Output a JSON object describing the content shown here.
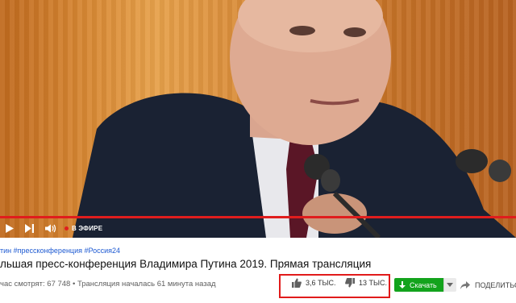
{
  "player": {
    "live_label": "В ЭФИРЕ",
    "progress": 1.0,
    "accent_color": "#e01d1d"
  },
  "video": {
    "hashtags": "тин #прессконференция #Россия24",
    "title": "льшая пресс-конференция Владимира Путина 2019. Прямая трансляция",
    "views_text": "час смотрят: 67 748",
    "started_text": "Трансляция началась 61 минута назад"
  },
  "actions": {
    "likes": "3,6 тыс.",
    "dislikes": "13 тыс.",
    "download_label": "Скачать",
    "share_label": "ПОДЕЛИТЬС",
    "download_color": "#13a31c",
    "highlight_color": "#e11b1b"
  },
  "icons": [
    "play-icon",
    "next-icon",
    "volume-icon",
    "thumbs-up-icon",
    "thumbs-down-icon",
    "download-icon",
    "chevron-down-icon",
    "share-icon"
  ]
}
